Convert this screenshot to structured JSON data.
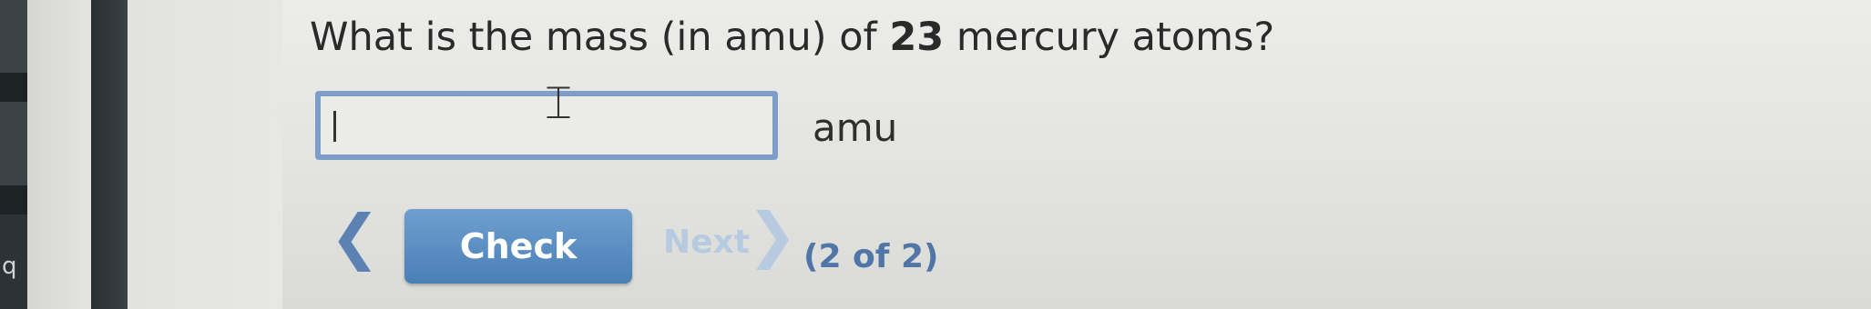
{
  "left_edge": {
    "glyph": "q"
  },
  "question": {
    "prefix": "What is the mass (in amu) of ",
    "count": "23",
    "suffix": " mercury atoms?"
  },
  "answer": {
    "value": "",
    "placeholder": "",
    "unit": "amu"
  },
  "nav": {
    "prev_icon": "chevron-left-icon",
    "check_label": "Check",
    "next_label": "Next",
    "next_icon": "chevron-right-icon",
    "page_counter": "(2 of 2)"
  },
  "colors": {
    "accent": "#4a7fb6",
    "input_border": "#7d9fc7",
    "disabled": "#b7cbe0"
  }
}
